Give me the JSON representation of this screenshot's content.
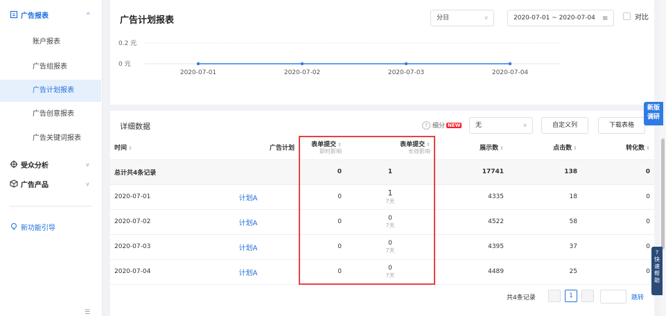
{
  "sidebar": {
    "sections": [
      {
        "label": "广告报表",
        "icon": "report-icon"
      },
      {
        "label": "受众分析",
        "icon": "target-icon"
      },
      {
        "label": "广告产品",
        "icon": "cube-icon"
      }
    ],
    "items": [
      {
        "label": "账户报表"
      },
      {
        "label": "广告组报表"
      },
      {
        "label": "广告计划报表"
      },
      {
        "label": "广告创意报表"
      },
      {
        "label": "广告关键词报表"
      }
    ],
    "guide": {
      "label": "新功能引导"
    }
  },
  "header": {
    "title": "广告计划报表",
    "granularity": "分日",
    "date_range": "2020-07-01 ~ 2020-07-04",
    "compare_label": "对比"
  },
  "chart_data": {
    "type": "line",
    "x": [
      "2020-07-01",
      "2020-07-02",
      "2020-07-03",
      "2020-07-04"
    ],
    "series": [
      {
        "values": [
          0,
          0,
          0,
          0
        ]
      }
    ],
    "ytick_labels": [
      "0.2 元",
      "0 元"
    ],
    "ylim": [
      0,
      0.2
    ],
    "color": "#2f7be5"
  },
  "detail": {
    "title": "详细数据",
    "breakdown_label": "细分",
    "new_badge": "NEW",
    "breakdown_value": "无",
    "custom_columns": "自定义列",
    "download": "下载表格",
    "columns": {
      "time": "时间",
      "plan": "广告计划",
      "form_instant": "表单提交",
      "form_instant_sub": "即时影响",
      "form_long": "表单提交",
      "form_long_sub": "长效影响",
      "impressions": "展示数",
      "clicks": "点击数",
      "conversions": "转化数"
    },
    "total": {
      "label": "总计共4条记录",
      "form_instant": "0",
      "form_long": "1",
      "impressions": "17741",
      "clicks": "138",
      "conversions": "0"
    },
    "rows": [
      {
        "date": "2020-07-01",
        "plan": "计划A",
        "form_instant": "0",
        "form_long": "1",
        "form_long_sub": "7天",
        "impressions": "4335",
        "clicks": "18",
        "conversions": "0"
      },
      {
        "date": "2020-07-02",
        "plan": "计划A",
        "form_instant": "0",
        "form_long": "0",
        "form_long_sub": "7天",
        "impressions": "4522",
        "clicks": "58",
        "conversions": "0"
      },
      {
        "date": "2020-07-03",
        "plan": "计划A",
        "form_instant": "0",
        "form_long": "0",
        "form_long_sub": "7天",
        "impressions": "4395",
        "clicks": "37",
        "conversions": "0"
      },
      {
        "date": "2020-07-04",
        "plan": "计划A",
        "form_instant": "0",
        "form_long": "0",
        "form_long_sub": "7天",
        "impressions": "4489",
        "clicks": "25",
        "conversions": "0"
      }
    ],
    "pagination": {
      "summary": "共4条记录",
      "current": "1",
      "jump": "跳转"
    }
  },
  "floating": {
    "survey": "新版调研",
    "help": "快速帮助"
  },
  "colors": {
    "accent": "#1e6fe0",
    "highlight": "#e8403d"
  }
}
